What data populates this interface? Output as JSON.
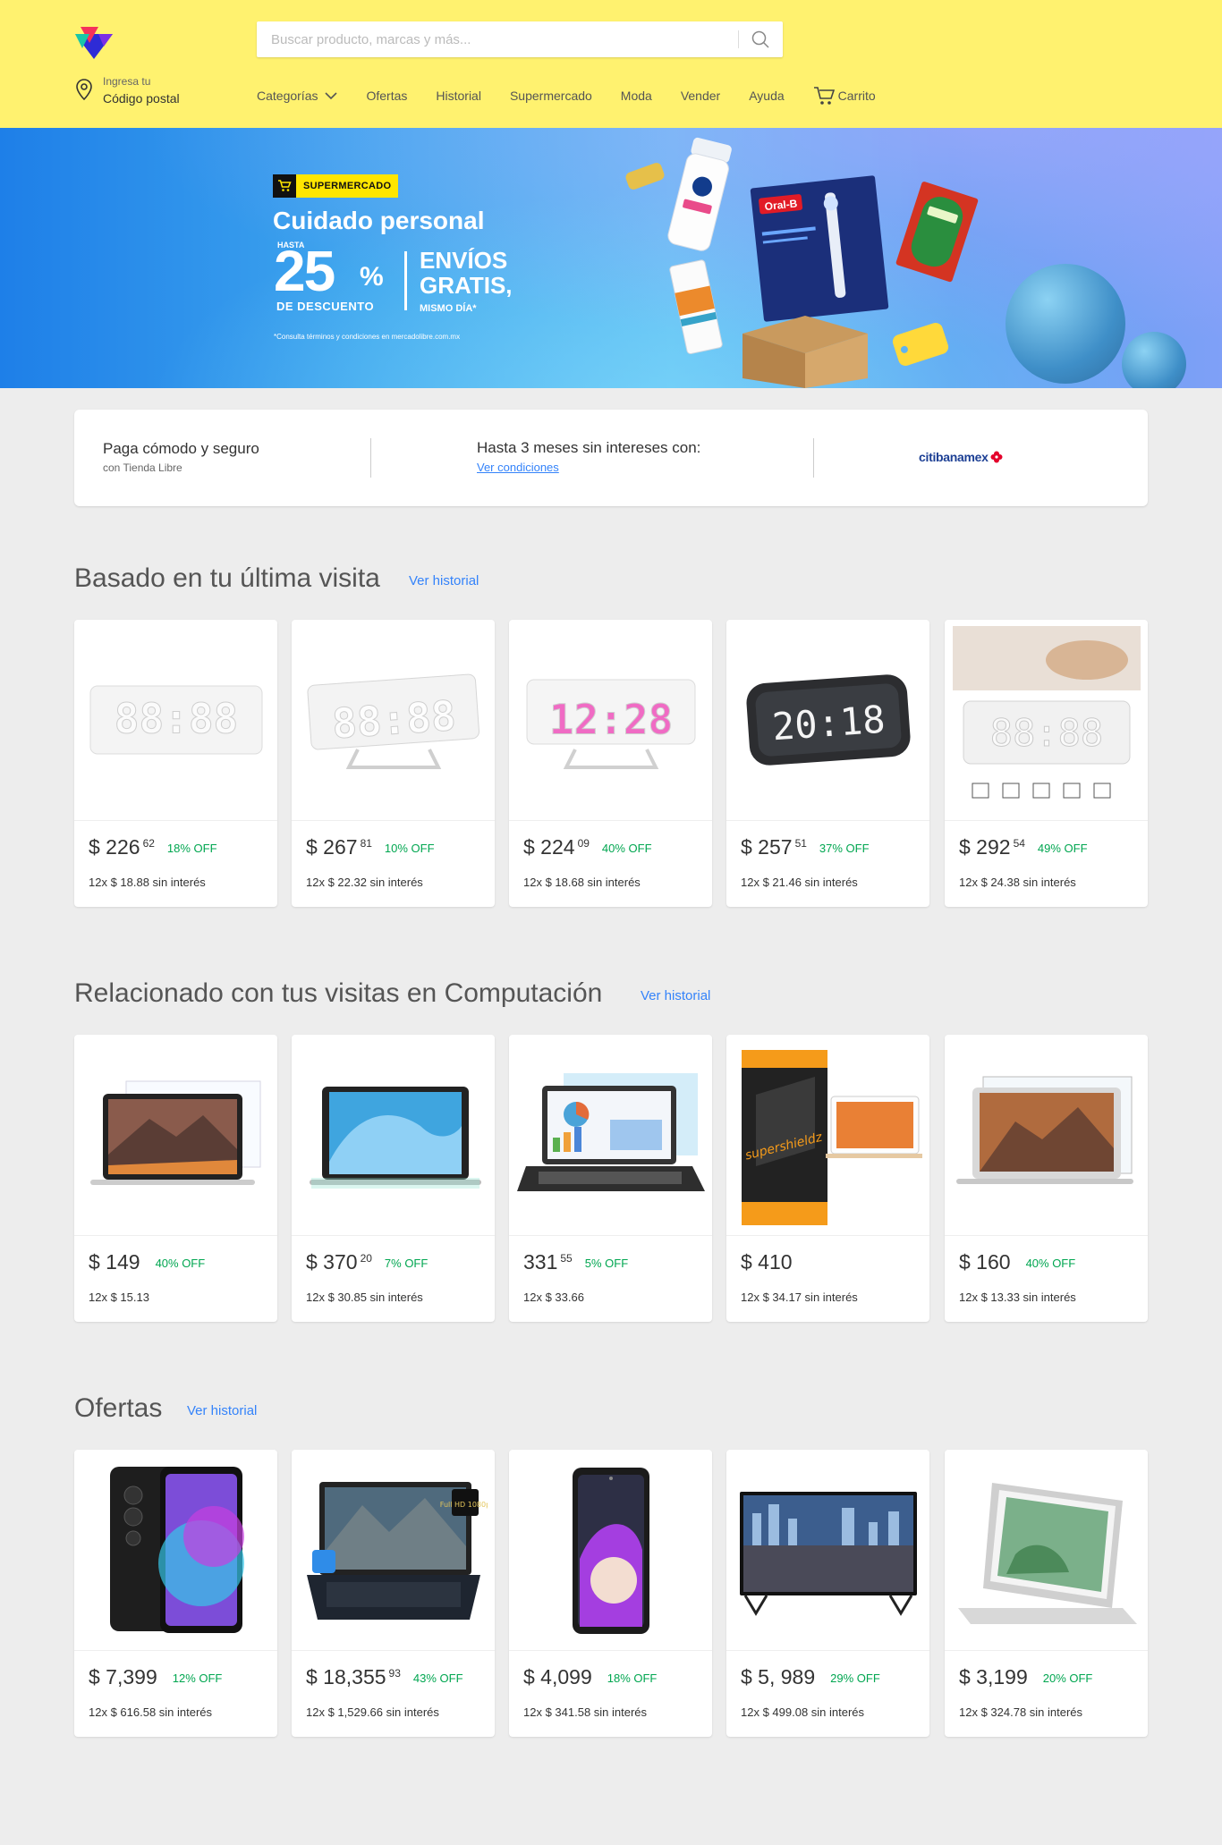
{
  "header": {
    "search_placeholder": "Buscar producto, marcas y más...",
    "location_line1": "Ingresa tu",
    "location_line2": "Código postal",
    "nav": [
      "Categorías",
      "Ofertas",
      "Historial",
      "Supermercado",
      "Moda",
      "Vender",
      "Ayuda",
      "Carrito"
    ]
  },
  "banner": {
    "badge": "SUPERMERCADO",
    "title": "Cuidado personal",
    "hasta": "HASTA",
    "percent": "25",
    "percent_sign": "%",
    "descuento": "DE DESCUENTO",
    "envios": "ENVÍOS",
    "gratis": "GRATIS,",
    "mismo_dia": "MISMO DÍA*",
    "legal": "*Consulta términos y condiciones en mercadolibre.com.mx"
  },
  "payment": {
    "title": "Paga cómodo y seguro",
    "subtitle": "con Tienda Libre",
    "installments": "Hasta 3 meses sin intereses con:",
    "conditions_link": "Ver condiciones",
    "bank": "citibanamex"
  },
  "sections": [
    {
      "title": "Basado en tu última visita",
      "link": "Ver historial",
      "items": [
        {
          "price": "$ 226",
          "cents": "62",
          "off": "18% OFF",
          "installments": "12x $ 18.88 sin interés"
        },
        {
          "price": "$ 267",
          "cents": "81",
          "off": "10% OFF",
          "installments": "12x $ 22.32 sin interés"
        },
        {
          "price": "$ 224",
          "cents": "09",
          "off": "40% OFF",
          "installments": "12x $ 18.68 sin interés"
        },
        {
          "price": "$ 257",
          "cents": "51",
          "off": "37% OFF",
          "installments": "12x $ 21.46 sin interés"
        },
        {
          "price": "$ 292",
          "cents": "54",
          "off": "49% OFF",
          "installments": "12x $ 24.38 sin interés"
        }
      ]
    },
    {
      "title": "Relacionado con tus visitas en Computación",
      "link": "Ver historial",
      "items": [
        {
          "price": "$ 149",
          "cents": "",
          "off": "40% OFF",
          "installments": "12x $ 15.13"
        },
        {
          "price": "$ 370",
          "cents": "20",
          "off": "7% OFF",
          "installments": "12x $ 30.85 sin interés"
        },
        {
          "price": "331",
          "cents": "55",
          "off": "5% OFF",
          "installments": "12x $ 33.66"
        },
        {
          "price": "$ 410",
          "cents": "",
          "off": "",
          "installments": "12x $ 34.17 sin interés"
        },
        {
          "price": "$ 160",
          "cents": "",
          "off": "40% OFF",
          "installments": "12x $ 13.33 sin interés"
        }
      ]
    },
    {
      "title": "Ofertas",
      "link": "Ver historial",
      "items": [
        {
          "price": "$ 7,399",
          "cents": "",
          "off": "12% OFF",
          "installments": "12x $ 616.58 sin interés"
        },
        {
          "price": "$ 18,355",
          "cents": "93",
          "off": "43% OFF",
          "installments": "12x $ 1,529.66 sin interés"
        },
        {
          "price": "$ 4,099",
          "cents": "",
          "off": "18% OFF",
          "installments": "12x $ 341.58 sin interés"
        },
        {
          "price": "$ 5, 989",
          "cents": "",
          "off": "29% OFF",
          "installments": "12x $ 499.08 sin interés"
        },
        {
          "price": "$ 3,199",
          "cents": "",
          "off": "20% OFF",
          "installments": "12x $ 324.78 sin interés"
        }
      ]
    }
  ],
  "product_images": {
    "clock_digits_1": "88:88",
    "clock_digits_3": "12:28",
    "clock_digits_4": "20:18",
    "screen_brand": "supershieldz",
    "tv_badge": "Full HD 1080p"
  },
  "colors": {
    "header_bg": "#fff26f",
    "link": "#3483fa",
    "discount": "#00a650",
    "page_bg": "#ededed"
  }
}
